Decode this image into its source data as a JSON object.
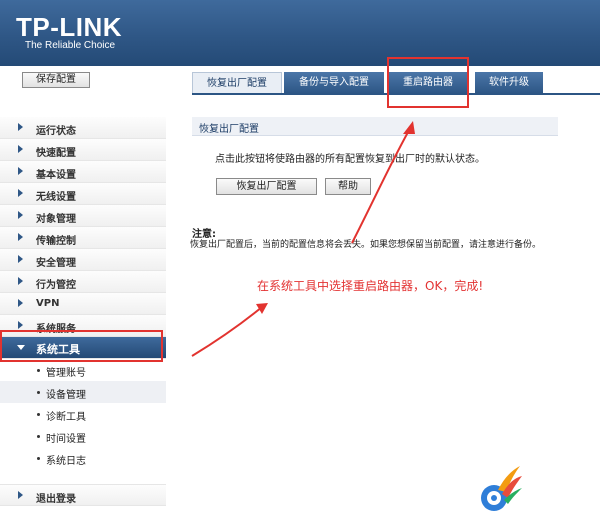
{
  "header": {
    "logo": "TP-LINK",
    "tagline": "The Reliable Choice"
  },
  "sidebar": {
    "save_label": "保存配置",
    "items": [
      {
        "label": "运行状态"
      },
      {
        "label": "快速配置"
      },
      {
        "label": "基本设置"
      },
      {
        "label": "无线设置"
      },
      {
        "label": "对象管理"
      },
      {
        "label": "传输控制"
      },
      {
        "label": "安全管理"
      },
      {
        "label": "行为管控"
      },
      {
        "label": "VPN"
      },
      {
        "label": "系统服务"
      },
      {
        "label": "系统工具"
      }
    ],
    "subitems": [
      {
        "label": "管理账号"
      },
      {
        "label": "设备管理"
      },
      {
        "label": "诊断工具"
      },
      {
        "label": "时间设置"
      },
      {
        "label": "系统日志"
      }
    ],
    "logout_label": "退出登录"
  },
  "tabs": [
    {
      "label": "恢复出厂配置"
    },
    {
      "label": "备份与导入配置"
    },
    {
      "label": "重启路由器"
    },
    {
      "label": "软件升级"
    }
  ],
  "panel": {
    "title": "恢复出厂配置",
    "description": "点击此按钮将使路由器的所有配置恢复到出厂时的默认状态。",
    "restore_button": "恢复出厂配置",
    "help_button": "帮助",
    "note_heading": "注意:",
    "note_text": "恢复出厂配置后，当前的配置信息将会丢失。如果您想保留当前配置，请注意进行备份。"
  },
  "annotation": "在系统工具中选择重启路由器，OK，完成!",
  "colors": {
    "header": "#2f5786",
    "highlight": "#e2332f",
    "annotation": "#e33333"
  }
}
